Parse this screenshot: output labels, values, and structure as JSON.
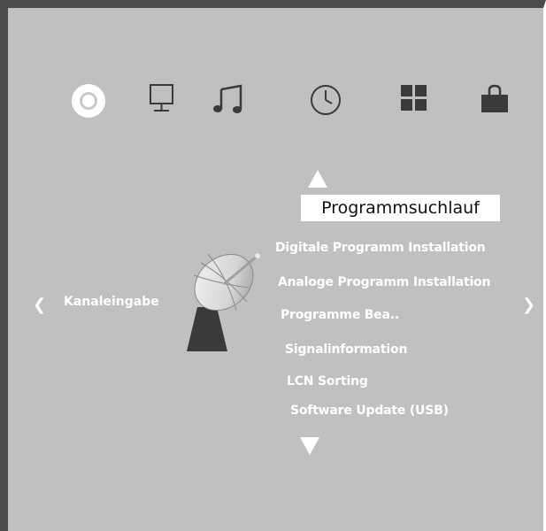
{
  "menu": {
    "icons": [
      "disc-icon",
      "monitor-icon",
      "music-note-icon",
      "clock-icon",
      "grid-icon",
      "bag-icon"
    ],
    "active_icon": "disc-icon"
  },
  "channel": {
    "title": "Programmsuchlauf",
    "left_label": "Kanaleingabe",
    "items": [
      {
        "label": "Digitale Programm Installation"
      },
      {
        "label": "Analoge Programm Installation"
      },
      {
        "label": "Programme Bea.."
      },
      {
        "label": "Signalinformation"
      },
      {
        "label": "LCN Sorting"
      },
      {
        "label": "Software Update (USB)"
      }
    ]
  },
  "colors": {
    "background": "#c0c0c0",
    "text": "#ffffff",
    "icon_dark": "#3a3a3a",
    "frame": "#4a4a4a"
  }
}
